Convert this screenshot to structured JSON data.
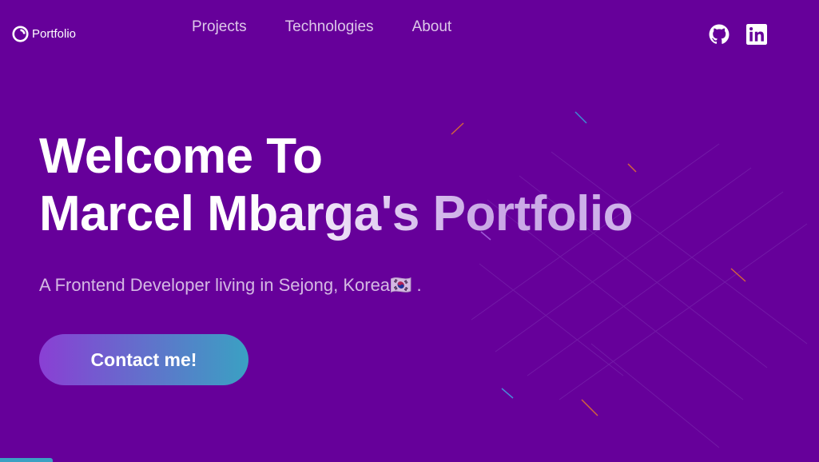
{
  "header": {
    "logo_text": "Portfolio",
    "nav": [
      {
        "label": "Projects"
      },
      {
        "label": "Technologies"
      },
      {
        "label": "About"
      }
    ],
    "social_icons": [
      "github-icon",
      "linkedin-icon"
    ]
  },
  "hero": {
    "title_line1": "Welcome To",
    "title_line2": "Marcel Mbarga's Portfolio",
    "subtitle": "A Frontend Developer living in Sejong, Korea🇰🇷 .",
    "cta_label": "Contact me!"
  },
  "colors": {
    "background": "#66009a",
    "button_gradient_start": "#8a3fd4",
    "button_gradient_end": "#3aa1c3"
  }
}
